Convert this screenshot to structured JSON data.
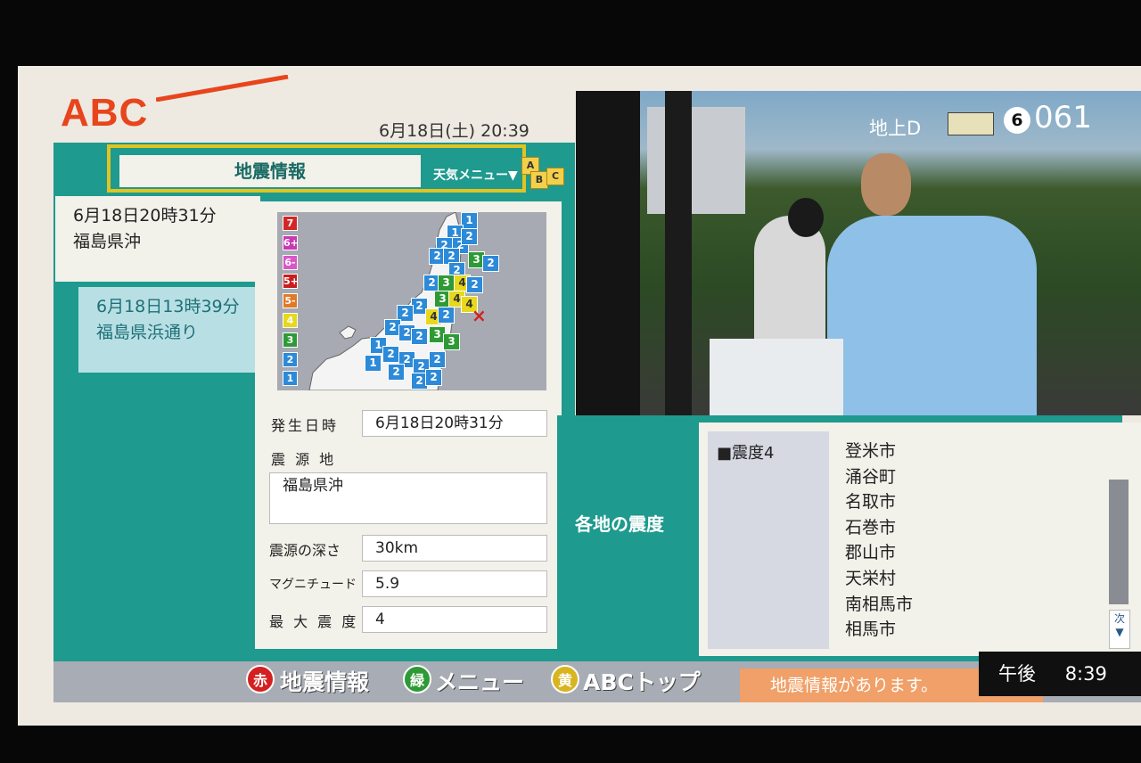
{
  "header": {
    "logo_text": "ABC",
    "datetime": "6月18日(土) 20:39"
  },
  "panel": {
    "title": "地震情報",
    "weather_menu": "天気メニュー▼",
    "weather_blocks": [
      "A",
      "B",
      "C"
    ]
  },
  "events": [
    {
      "time": "6月18日20時31分",
      "region": "福島県沖",
      "selected": true
    },
    {
      "time": "6月18日13時39分",
      "region": "福島県浜通り",
      "selected": false
    }
  ],
  "map": {
    "legend": [
      "7",
      "6+",
      "6-",
      "5+",
      "5-",
      "4",
      "3",
      "2",
      "1"
    ],
    "legend_colors": [
      "#d42626",
      "#c83ab4",
      "#d858c8",
      "#c81e1e",
      "#e07a26",
      "#e8d81c",
      "#2e9a36",
      "#2c8ad8",
      "#2c8ad8"
    ],
    "epicenter_symbol": "×"
  },
  "details": {
    "occurred_label": "発生日時",
    "occurred_value": "6月18日20時31分",
    "epicenter_label": "震 源 地",
    "epicenter_value": "福島県沖",
    "depth_label": "震源の深さ",
    "depth_value": "30km",
    "magnitude_label": "マグニチュード",
    "magnitude_value": "5.9",
    "max_intensity_label": "最 大 震 度",
    "max_intensity_value": "4"
  },
  "broadcast": {
    "channel_label": "地上D",
    "channel_button": "6",
    "channel_number": "061"
  },
  "intensity": {
    "heading": "各地の震度",
    "level": "■震度4",
    "cities": [
      "登米市",
      "涌谷町",
      "名取市",
      "石巻市",
      "郡山市",
      "天栄村",
      "南相馬市",
      "相馬市"
    ],
    "next_label": "次"
  },
  "footer": {
    "red_key": "赤",
    "red_label": "地震情報",
    "green_key": "緑",
    "green_label": "メニュー",
    "yellow_key": "黄",
    "yellow_label": "ABCトップ",
    "ticker": "地震情報があります。"
  },
  "clock": {
    "ampm": "午後",
    "time": "8:39"
  },
  "colors": {
    "teal": "#1e9a8e",
    "brand_orange": "#e8451c",
    "title_border": "#e1c321"
  }
}
